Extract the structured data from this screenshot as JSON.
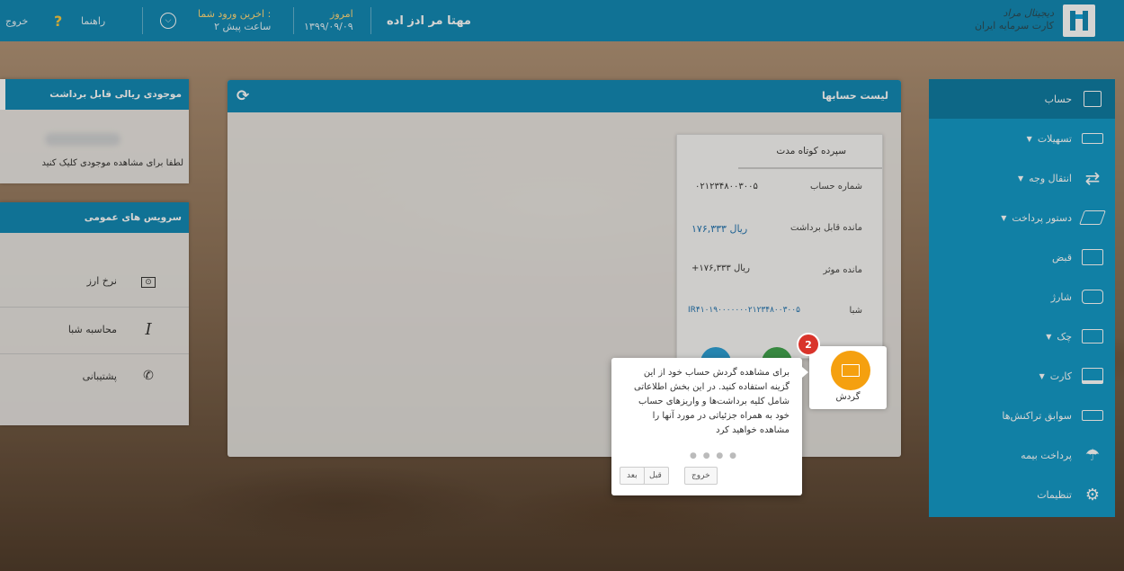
{
  "topbar": {
    "user_name": "مهتا مر ادز اده",
    "today_label": "امروز",
    "today_date": "۱۳۹۹/۰۹/۰۹",
    "last_login_label": "اخرین ورود شما :",
    "last_login_value": "۲ ساعت پیش",
    "help_label": "راهنما",
    "help_icon": "?",
    "exit_label": "خروج",
    "bank_logo_line1": "دیجیتال مراد",
    "bank_logo_line2": "کارت سرمایه ایران"
  },
  "sidebar": {
    "items": [
      {
        "label": "حساب",
        "icon": "wallet-icon"
      },
      {
        "label": "تسهیلات",
        "icon": "loan-icon",
        "caret": "▼"
      },
      {
        "label": "انتقال وجه",
        "icon": "transfer-icon",
        "caret": "▼"
      },
      {
        "label": "دستور پرداخت",
        "icon": "payment-order-icon",
        "caret": "▼"
      },
      {
        "label": "قبض",
        "icon": "bill-icon"
      },
      {
        "label": "شارژ",
        "icon": "charge-icon"
      },
      {
        "label": "چک",
        "icon": "cheque-icon",
        "caret": "▼"
      },
      {
        "label": "کارت",
        "icon": "card-icon",
        "caret": "▼"
      },
      {
        "label": "سوابق تراکنش‌ها",
        "icon": "history-icon"
      },
      {
        "label": "پرداخت بیمه",
        "icon": "umbrella-icon"
      },
      {
        "label": "تنظیمات",
        "icon": "gear-icon"
      }
    ]
  },
  "main": {
    "title": "لیست حسابها",
    "refresh_icon": "⟳",
    "card": {
      "title": "سپرده کوتاه مدت",
      "rows": [
        {
          "label": "شماره حساب",
          "value": "۰۲۱۲۳۴۸۰۰۳۰۰۵"
        },
        {
          "label": "مانده قابل برداشت",
          "value": "۱۷۶,۳۳۳ ریال"
        },
        {
          "label": "مانده موثر",
          "value": "+۱۷۶,۳۳۳ ریال"
        },
        {
          "label": "شبا",
          "value": "IR۴۱۰۱۹۰۰۰۰۰۰۰۲۱۲۳۴۸۰۰۳۰۰۵"
        }
      ]
    }
  },
  "balance_box": {
    "title": "موجودی ریالی قابل برداشت",
    "hint": "لطفا برای مشاهده موجودی کلیک کنید"
  },
  "services_box": {
    "title": "سرویس های عمومی",
    "items": [
      {
        "label": "نرخ ارز",
        "icon": "currency-icon"
      },
      {
        "label": "محاسبه شبا",
        "icon": "italic-i-icon"
      },
      {
        "label": "پشتیبانی",
        "icon": "phone-icon"
      }
    ]
  },
  "tour": {
    "step": "2",
    "target_label": "گردش",
    "text": "برای مشاهده گردش حساب خود از این گزینه استفاده کنید. در این بخش اطلاعاتی شامل کلیه برداشت‌ها و واریزهای حساب خود به همراه جزئیاتی در مورد آنها را مشاهده خواهید کرد",
    "dots": "● ● ● ●",
    "buttons": {
      "exit": "خروج",
      "prev": "قبل",
      "next": "بعد"
    }
  }
}
